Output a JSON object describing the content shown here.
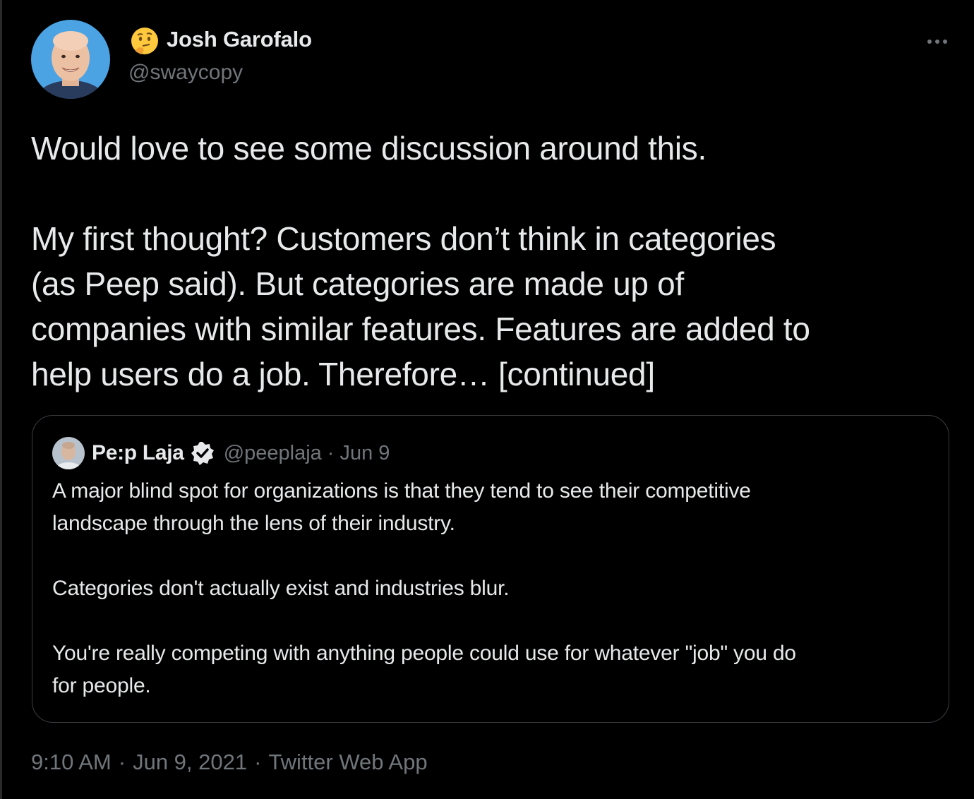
{
  "tweet": {
    "author": {
      "emoji": "🤔",
      "name": "Josh Garofalo",
      "handle": "@swaycopy"
    },
    "more_icon": "more-horizontal-icon",
    "text": {
      "line1": "Would love to see some discussion around this.",
      "line2": "My first thought? Customers don’t think in categories",
      "line3": "(as Peep said). But categories are made up of",
      "line4": "companies with similar features. Features are added to",
      "line5": "help users do a job. Therefore… [continued]"
    },
    "quoted": {
      "name": "Pe:p Laja",
      "verified_icon": "verified-badge-icon",
      "handle": "@peeplaja",
      "separator": "·",
      "date": "Jun 9",
      "body": {
        "line1": "A major blind spot for organizations is that they tend to see their competitive",
        "line2": "landscape through the lens of their industry.",
        "line3": "Categories don't actually exist and industries blur.",
        "line4": "You're really competing with anything people could use for whatever \"job\" you do",
        "line5": "for people."
      }
    },
    "footer": {
      "time": "9:10 AM",
      "separator": "·",
      "date": "Jun 9, 2021",
      "source": "Twitter Web App"
    }
  },
  "colors": {
    "background": "#000000",
    "text_primary": "#e7e9ea",
    "text_secondary": "#71767b",
    "border": "#3a3d41",
    "avatar_bg": "#4ba3e3"
  }
}
